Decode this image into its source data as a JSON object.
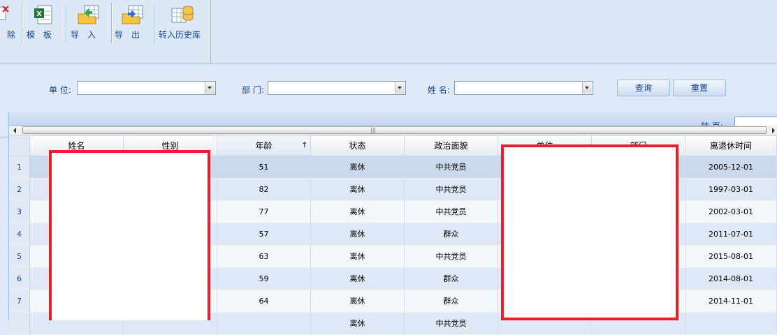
{
  "toolbar": {
    "delete_label": "除",
    "template_label": "模　板",
    "import_label": "导　入",
    "export_label": "导　出",
    "history_label": "转入历史库"
  },
  "search": {
    "unit_label": "单 位:",
    "dept_label": "部 门:",
    "name_label": "姓 名:",
    "query_label": "查询",
    "reset_label": "重置"
  },
  "grid": {
    "jump_label": "转 页:",
    "columns": [
      "姓名",
      "性别",
      "年龄",
      "状态",
      "政治面貌",
      "单位",
      "部门",
      "离退休时间"
    ],
    "rows": [
      {
        "no": "1",
        "age": "51",
        "status": "离休",
        "political": "中共党员",
        "date": "2005-12-01"
      },
      {
        "no": "2",
        "age": "82",
        "status": "离休",
        "political": "中共党员",
        "date": "1997-03-01"
      },
      {
        "no": "3",
        "age": "77",
        "status": "离休",
        "political": "中共党员",
        "date": "2002-03-01"
      },
      {
        "no": "4",
        "age": "57",
        "status": "离休",
        "political": "群众",
        "date": "2011-07-01"
      },
      {
        "no": "5",
        "age": "63",
        "status": "离休",
        "political": "中共党员",
        "date": "2015-08-01"
      },
      {
        "no": "6",
        "age": "59",
        "status": "离休",
        "political": "群众",
        "date": "2014-08-01"
      },
      {
        "no": "7",
        "age": "64",
        "status": "离休",
        "political": "群众",
        "date": "2014-11-01"
      },
      {
        "no": "",
        "age": "",
        "status": "离休",
        "political": "中共党员",
        "date": ""
      }
    ]
  },
  "colors": {
    "accent": "#15428b",
    "redaction_border": "#e3202c",
    "selected_row": "#cad9ec"
  }
}
